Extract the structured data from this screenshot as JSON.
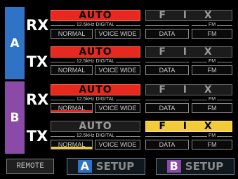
{
  "colors": {
    "group_a": "#2f72c6",
    "group_b": "#8b4aa8",
    "active_red": "#e8281e",
    "active_yellow": "#f2cb38",
    "inactive": "#1c1c1c"
  },
  "groups": [
    {
      "letter": "A",
      "rows": [
        {
          "label": "RX",
          "auto": "AUTO",
          "fix": "F I X",
          "sub": "12.5kHz DIGITAL",
          "fm_cap": "FM",
          "normal": "NORMAL",
          "voice": "VOICE WIDE",
          "data": "DATA",
          "fm": "FM"
        },
        {
          "label": "TX",
          "auto": "AUTO",
          "fix": "F I X",
          "sub": "12.5kHz DIGITAL",
          "fm_cap": "FM",
          "normal": "NORMAL",
          "voice": "VOICE WIDE",
          "data": "DATA",
          "fm": "FM"
        }
      ]
    },
    {
      "letter": "B",
      "rows": [
        {
          "label": "RX",
          "auto": "AUTO",
          "fix": "F I X",
          "sub": "12.5kHz DIGITAL",
          "fm_cap": "FM",
          "normal": "NORMAL",
          "voice": "VOICE WIDE",
          "data": "DATA",
          "fm": "FM"
        },
        {
          "label": "TX",
          "auto": "AUTO",
          "fix": "F I X",
          "sub": "12.5kHz DIGITAL",
          "fm_cap": "FM",
          "normal": "NORMAL",
          "voice": "VOICE WIDE",
          "data": "DATA",
          "fm": "FM"
        }
      ]
    }
  ],
  "footer": {
    "remote": "REMOTE",
    "setup_a_letter": "A",
    "setup_a_label": "SETUP",
    "setup_b_letter": "B",
    "setup_b_label": "SETUP"
  }
}
